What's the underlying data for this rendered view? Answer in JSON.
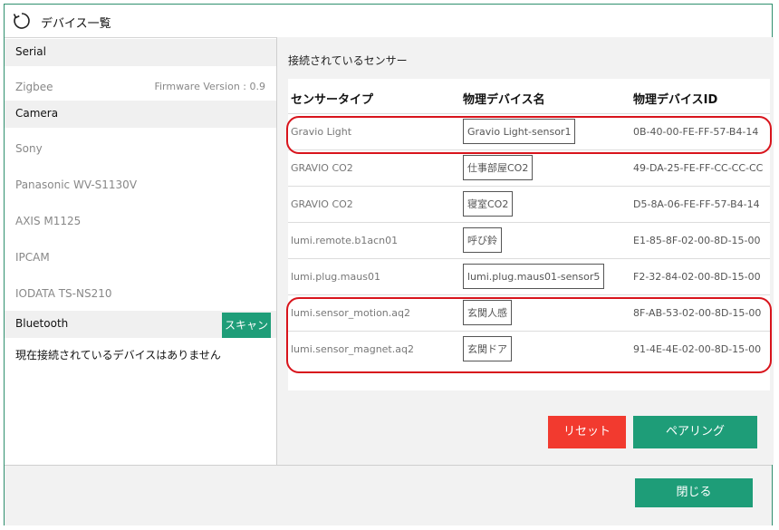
{
  "dialog": {
    "title": "デバイス一覧"
  },
  "left": {
    "serial": {
      "header": "Serial",
      "item": "Zigbee",
      "firmware": "Firmware Version : 0.9"
    },
    "camera": {
      "header": "Camera",
      "items": [
        "Sony",
        "Panasonic WV-S1130V",
        "AXIS M1125",
        "IPCAM",
        "IODATA TS-NS210"
      ]
    },
    "bluetooth": {
      "header": "Bluetooth",
      "scan_label": "スキャン",
      "empty_message": "現在接続されているデバイスはありません"
    }
  },
  "right": {
    "title": "接続されているセンサー",
    "columns": [
      "センサータイプ",
      "物理デバイス名",
      "物理デバイスID"
    ],
    "rows": [
      {
        "type": "Gravio Light",
        "name": "Gravio Light-sensor1",
        "id": "0B-40-00-FE-FF-57-B4-14"
      },
      {
        "type": "GRAVIO CO2",
        "name": "仕事部屋CO2",
        "id": "49-DA-25-FE-FF-CC-CC-CC"
      },
      {
        "type": "GRAVIO CO2",
        "name": "寝室CO2",
        "id": "D5-8A-06-FE-FF-57-B4-14"
      },
      {
        "type": "lumi.remote.b1acn01",
        "name": "呼び鈴",
        "id": "E1-85-8F-02-00-8D-15-00"
      },
      {
        "type": "lumi.plug.maus01",
        "name": "lumi.plug.maus01-sensor5",
        "id": "F2-32-84-02-00-8D-15-00"
      },
      {
        "type": "lumi.sensor_motion.aq2",
        "name": "玄関人感",
        "id": "8F-AB-53-02-00-8D-15-00"
      },
      {
        "type": "lumi.sensor_magnet.aq2",
        "name": "玄関ドア",
        "id": "91-4E-4E-02-00-8D-15-00"
      }
    ],
    "reset_label": "リセット",
    "pairing_label": "ペアリング"
  },
  "footer": {
    "close_label": "閉じる"
  },
  "colors": {
    "accent": "#1e9d78",
    "danger": "#f23a2f",
    "highlight": "#d8141c"
  }
}
